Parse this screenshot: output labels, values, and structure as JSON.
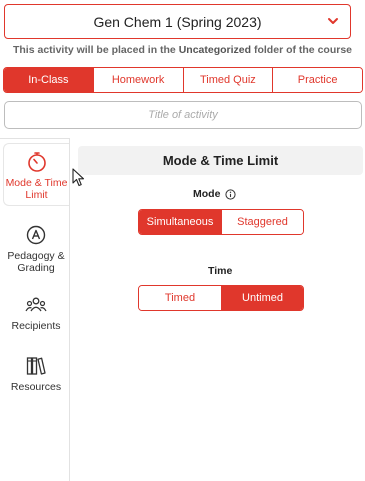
{
  "course_select": {
    "value": "Gen Chem 1 (Spring 2023)",
    "icon": "chevron-down-icon"
  },
  "placement_note": {
    "prefix": "This activity will be placed in the",
    "folder": "Uncategorized",
    "suffix": "folder of the course"
  },
  "activity_types": [
    {
      "label": "In-Class",
      "active": true
    },
    {
      "label": "Homework",
      "active": false
    },
    {
      "label": "Timed Quiz",
      "active": false
    },
    {
      "label": "Practice",
      "active": false
    }
  ],
  "title_input": {
    "value": "",
    "placeholder": "Title of activity"
  },
  "sidebar": {
    "items": [
      {
        "label": "Mode & Time Limit",
        "icon": "stopwatch-icon",
        "active": true
      },
      {
        "label": "Pedagogy & Grading",
        "icon": "compass-icon",
        "active": false
      },
      {
        "label": "Recipients",
        "icon": "people-icon",
        "active": false
      },
      {
        "label": "Resources",
        "icon": "books-icon",
        "active": false
      }
    ]
  },
  "panel": {
    "title": "Mode & Time Limit",
    "mode": {
      "label": "Mode",
      "info_icon": "info-icon",
      "options": [
        {
          "label": "Simultaneous",
          "active": true
        },
        {
          "label": "Staggered",
          "active": false
        }
      ]
    },
    "time": {
      "label": "Time",
      "options": [
        {
          "label": "Timed",
          "active": false
        },
        {
          "label": "Untimed",
          "active": true
        }
      ]
    }
  },
  "colors": {
    "accent": "#e0372c",
    "border": "#bdbdbd",
    "header_bg": "#f2f2f2"
  }
}
